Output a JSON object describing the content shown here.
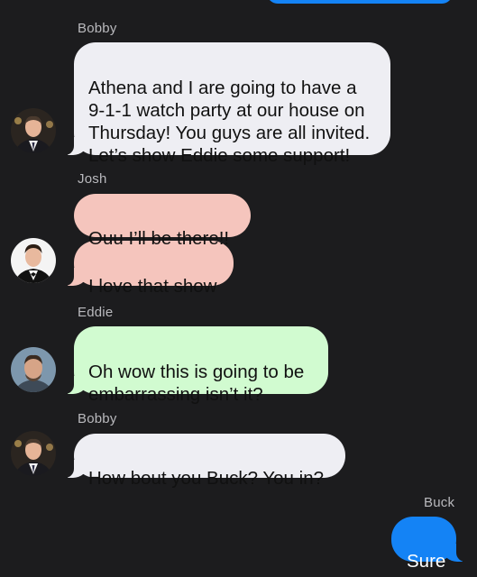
{
  "colors": {
    "background": "#1c1c1e",
    "bobby_bubble": "#eeeef3",
    "josh_bubble": "#f5c5bd",
    "eddie_bubble": "#d1fbd0",
    "outgoing_bubble": "#1483f5",
    "sender_label": "#b9b9bd"
  },
  "messages": {
    "m1": {
      "sender": "Bobby",
      "text": "Athena and I are going to have a\n9-1-1 watch party at our house on\nThursday! You guys are all invited.\nLet’s show Eddie some support!"
    },
    "m2": {
      "sender": "Josh",
      "text_a": "Ouu I’ll be there!!",
      "text_b": "I love that show"
    },
    "m3": {
      "sender": "Eddie",
      "text": "Oh wow this is going to be\nembarrassing isn’t it?"
    },
    "m4": {
      "sender": "Bobby",
      "text": "How bout you Buck? You in?"
    },
    "m5": {
      "sender": "Buck",
      "text": "Sure"
    }
  },
  "icons": {
    "bobby_avatar": "person-avatar-icon",
    "josh_avatar": "person-avatar-icon",
    "eddie_avatar": "person-avatar-icon"
  }
}
